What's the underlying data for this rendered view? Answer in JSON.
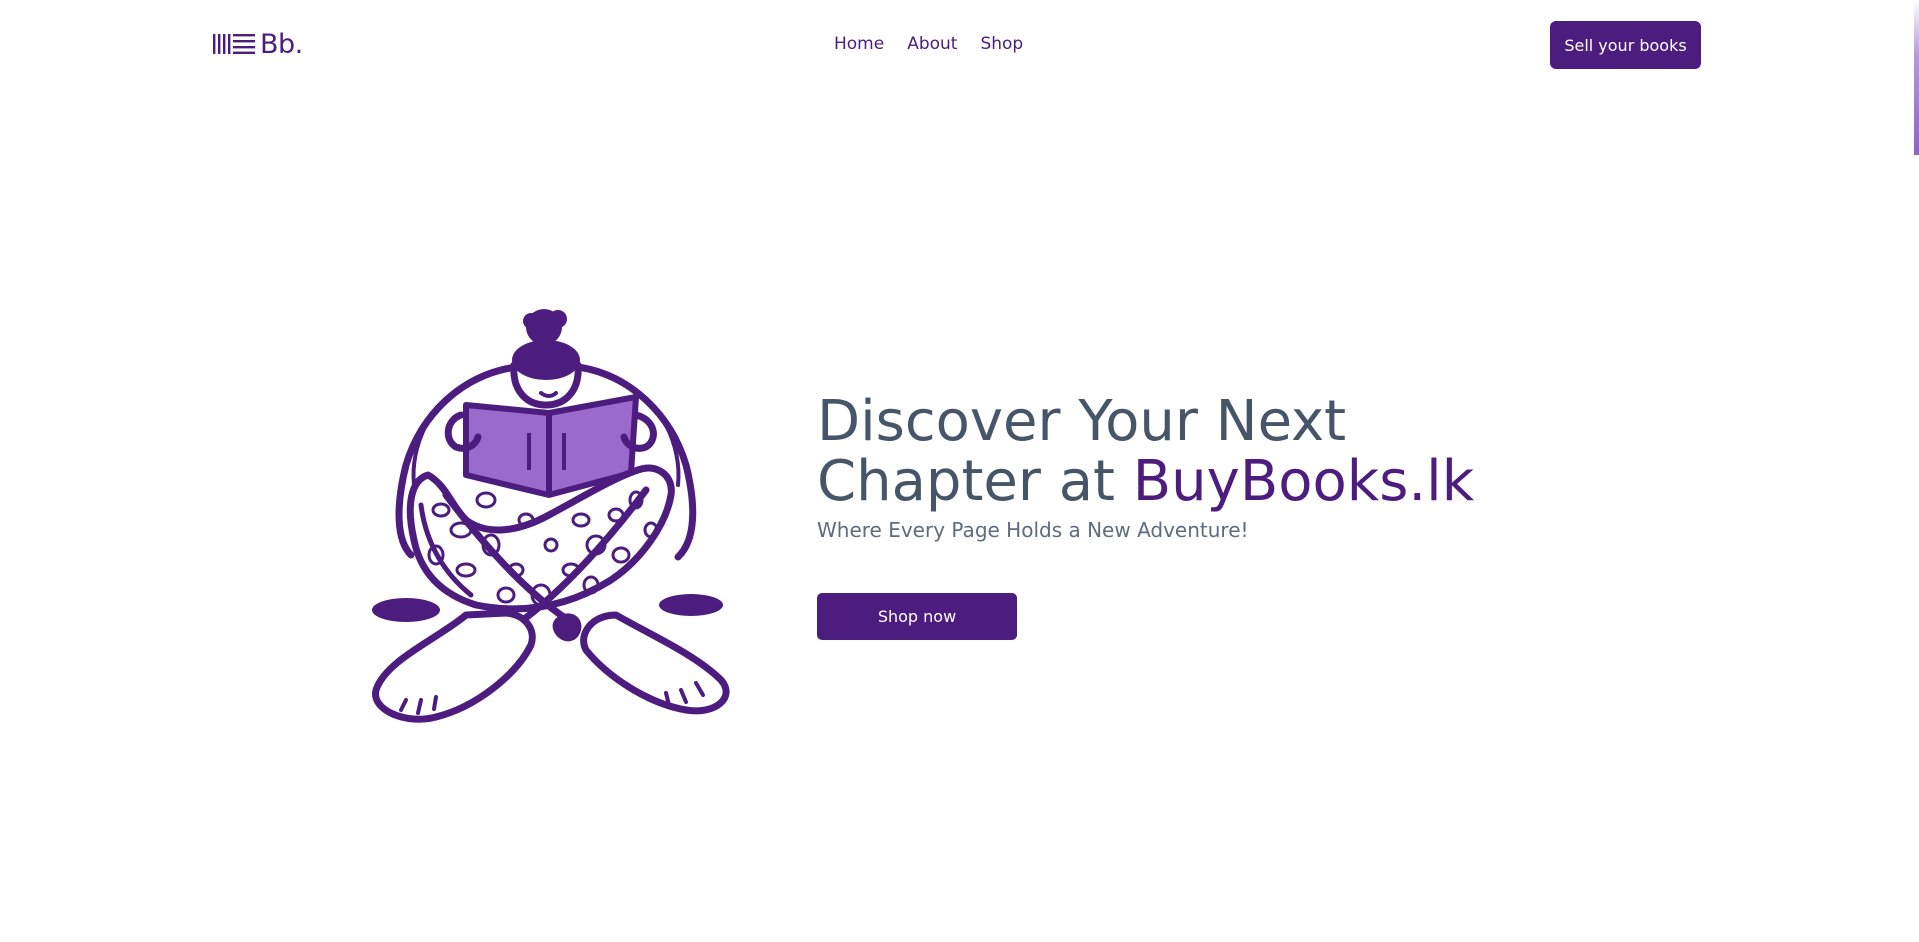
{
  "brand": {
    "logo_text": "Bb.",
    "logo_icon": "book-stack-icon",
    "accent_color": "#4c1d7e",
    "illustration_fill": "#9a6bcc"
  },
  "nav": {
    "items": [
      {
        "label": "Home"
      },
      {
        "label": "About"
      },
      {
        "label": "Shop"
      }
    ],
    "cta_label": "Sell your books"
  },
  "hero": {
    "title_line1": "Discover Your Next",
    "title_line2_prefix": "Chapter at ",
    "title_brand": "BuyBooks.lk",
    "subtitle": "Where Every Page Holds a New Adventure!",
    "button_label": "Shop now",
    "illustration": "person-reading-book-illustration"
  }
}
